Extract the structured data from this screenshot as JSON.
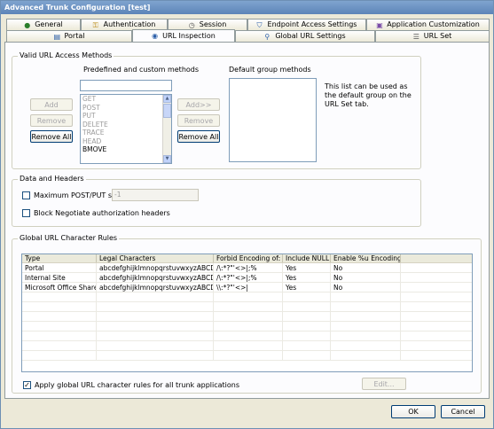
{
  "window": {
    "title": "Advanced Trunk Configuration [test]"
  },
  "tabs_row1": [
    {
      "label": "General",
      "icon": "globe-icon"
    },
    {
      "label": "Authentication",
      "icon": "key-icon"
    },
    {
      "label": "Session",
      "icon": "clock-icon"
    },
    {
      "label": "Endpoint Access Settings",
      "icon": "shield-icon"
    },
    {
      "label": "Application Customization",
      "icon": "app-icon"
    }
  ],
  "tabs_row2": [
    {
      "label": "Portal",
      "icon": "portal-icon"
    },
    {
      "label": "URL Inspection",
      "icon": "inspection-icon",
      "active": true
    },
    {
      "label": "Global URL Settings",
      "icon": "magnifier-icon"
    },
    {
      "label": "URL Set",
      "icon": "list-icon"
    }
  ],
  "valid_methods": {
    "group_title": "Valid URL Access Methods",
    "predefined_label": "Predefined and custom methods",
    "method_input_value": "",
    "methods": [
      "GET",
      "POST",
      "PUT",
      "DELETE",
      "TRACE",
      "HEAD",
      "BMOVE"
    ],
    "add_label": "Add",
    "remove_label": "Remove",
    "remove_all_label": "Remove All",
    "add_to_default_label": "Add>>",
    "remove_default_label": "Remove",
    "remove_all_default_label": "Remove All",
    "default_group_label": "Default group methods",
    "default_group_note": "This list can be used as the default group on the URL Set tab."
  },
  "data_headers": {
    "group_title": "Data and Headers",
    "max_post_label": "Maximum POST/PUT size:",
    "max_post_value": "-1",
    "max_post_checked": false,
    "block_negotiate_label": "Block Negotiate authorization headers",
    "block_negotiate_checked": false
  },
  "char_rules": {
    "group_title": "Global URL Character Rules",
    "columns": [
      "Type",
      "Legal Characters",
      "Forbid Encoding of:",
      "Include NULL",
      "Enable %u Encoding"
    ],
    "rows": [
      [
        "Portal",
        "abcdefghijklmnopqrstuvwxyzABCD...",
        "/\\:*?\"'<>|;%",
        "Yes",
        "No"
      ],
      [
        "Internal Site",
        "abcdefghijklmnopqrstuvwxyzABCD...",
        "/\\:*?\"'<>|;%",
        "Yes",
        "No"
      ],
      [
        "Microsoft Office Share...",
        "abcdefghijklmnopqrstuvwxyzABCD...",
        "\\\\:*?\"'<>|",
        "Yes",
        "No"
      ]
    ],
    "apply_label": "Apply global URL character rules for all trunk applications",
    "apply_checked": true,
    "edit_label": "Edit..."
  },
  "footer": {
    "ok_label": "OK",
    "cancel_label": "Cancel"
  }
}
